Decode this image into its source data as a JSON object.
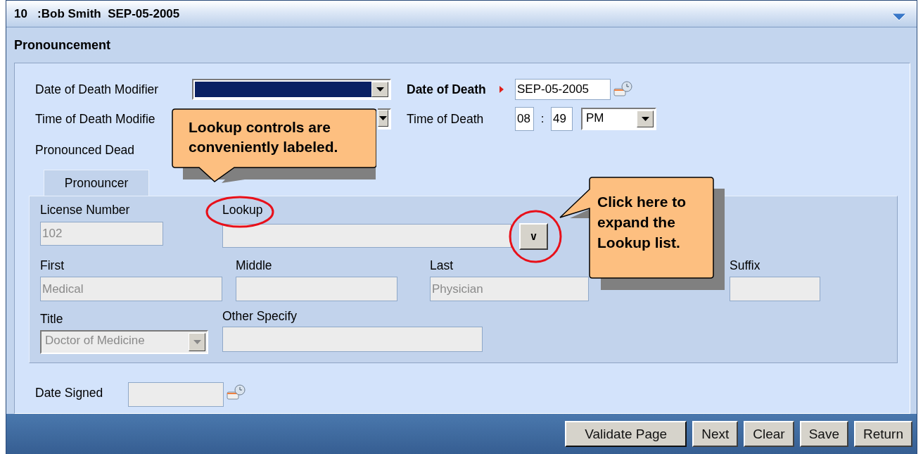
{
  "window": {
    "title": "10   :Bob Smith  SEP-05-2005"
  },
  "section": {
    "title": "Pronouncement"
  },
  "date_of_death_modifier": {
    "label": "Date of Death Modifier",
    "highlighted": true
  },
  "time_of_death_modifier": {
    "label": "Time of Death Modifie"
  },
  "date_of_death": {
    "label": "Date of Death",
    "required": true,
    "value": "SEP-05-2005"
  },
  "time_of_death": {
    "label": "Time of Death",
    "hour": "08",
    "separator": ":",
    "minute": "49",
    "meridiem": "PM"
  },
  "pronounced_dead": {
    "label": "Pronounced Dead"
  },
  "tabs": [
    {
      "label": "Pronouncer",
      "selected": true
    }
  ],
  "pronouncer": {
    "license_number": {
      "label": "License Number",
      "value": "102",
      "disabled": true
    },
    "lookup": {
      "label": "Lookup",
      "button": "v",
      "disabled": true
    },
    "name_fields": [
      {
        "label": "First",
        "value": "Medical",
        "disabled": true
      },
      {
        "label": "Middle",
        "disabled": true
      },
      {
        "label": "Last",
        "value": "Physician",
        "disabled": true
      },
      {
        "label": "Suffix",
        "disabled": true
      }
    ],
    "title": {
      "label": "Title",
      "value": "Doctor of Medicine",
      "disabled": true
    },
    "other_specify": {
      "label": "Other Specify",
      "disabled": true
    }
  },
  "date_signed": {
    "label": "Date Signed",
    "disabled": true
  },
  "buttons": [
    "Validate Page",
    "Next",
    "Clear",
    "Save",
    "Return"
  ],
  "callouts": [
    {
      "text": "Lookup controls are conveniently labeled."
    },
    {
      "text": "Click here to expand the Lookup list."
    }
  ]
}
